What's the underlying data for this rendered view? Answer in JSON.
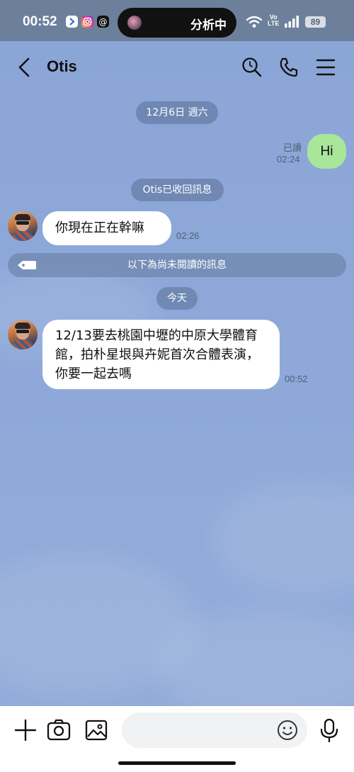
{
  "status_bar": {
    "time": "00:52",
    "dynamic_island_text": "分析中",
    "volte_top": "Vo",
    "volte_bottom": "LTE",
    "battery": "89"
  },
  "header": {
    "title": "Otis"
  },
  "messages": {
    "date_pill": "12月6日 週六",
    "sent_text": "Hi",
    "sent_read_label": "已讀",
    "sent_time": "02:24",
    "system_notice": "Otis已收回訊息",
    "recv1_text": "你現在正在幹嘛",
    "recv1_time": "02:26",
    "unread_divider": "以下為尚未閱讀的訊息",
    "today_pill": "今天",
    "recv2_text": "12/13要去桃園中壢的中原大學體育館，拍朴星垠與卉妮首次合體表演，你要一起去嗎",
    "recv2_time": "00:52"
  },
  "composer": {
    "placeholder": ""
  },
  "colors": {
    "background": "#8ea9d9",
    "sent_bubble": "#a8e69a",
    "received_bubble": "#ffffff",
    "pill": "#5a7096"
  }
}
